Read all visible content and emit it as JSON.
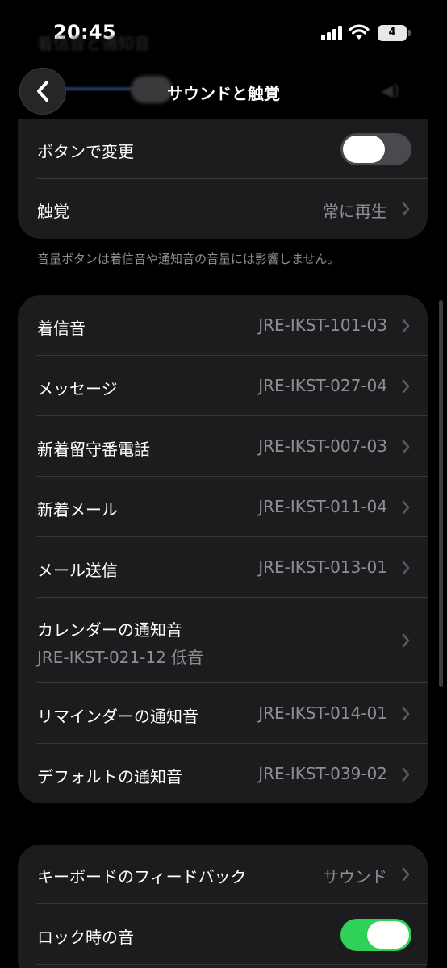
{
  "status_bar": {
    "time": "20:45",
    "battery_level": "4",
    "icons": [
      "cellular-signal-icon",
      "wifi-icon",
      "battery-icon"
    ]
  },
  "header": {
    "title": "サウンドと触覚",
    "back_icon": "chevron-left-icon",
    "ghost_title": "着信音と通知音"
  },
  "volume_group": {
    "change_with_buttons": {
      "label": "ボタンで変更",
      "on": false
    },
    "haptics": {
      "label": "触覚",
      "value": "常に再生"
    },
    "footnote": "音量ボタンは着信音や通知音の音量には影響しません。"
  },
  "sounds_group": {
    "rows": [
      {
        "label": "着信音",
        "value": "JRE-IKST-101-03"
      },
      {
        "label": "メッセージ",
        "value": "JRE-IKST-027-04"
      },
      {
        "label": "新着留守番電話",
        "value": "JRE-IKST-007-03"
      },
      {
        "label": "新着メール",
        "value": "JRE-IKST-011-04"
      },
      {
        "label": "メール送信",
        "value": "JRE-IKST-013-01"
      },
      {
        "label": "カレンダーの通知音",
        "value": "JRE-IKST-021-12 低音"
      },
      {
        "label": "リマインダーの通知音",
        "value": "JRE-IKST-014-01"
      },
      {
        "label": "デフォルトの通知音",
        "value": "JRE-IKST-039-02"
      }
    ]
  },
  "feedback_group": {
    "keyboard_feedback": {
      "label": "キーボードのフィードバック",
      "value": "サウンド"
    },
    "lock_sound": {
      "label": "ロック時の音",
      "on": true
    }
  },
  "colors": {
    "background": "#000000",
    "cell": "#1c1c1e",
    "toggle_on": "#30d158",
    "toggle_off": "#4a4a4e",
    "secondary_text": "#8e8e93"
  }
}
